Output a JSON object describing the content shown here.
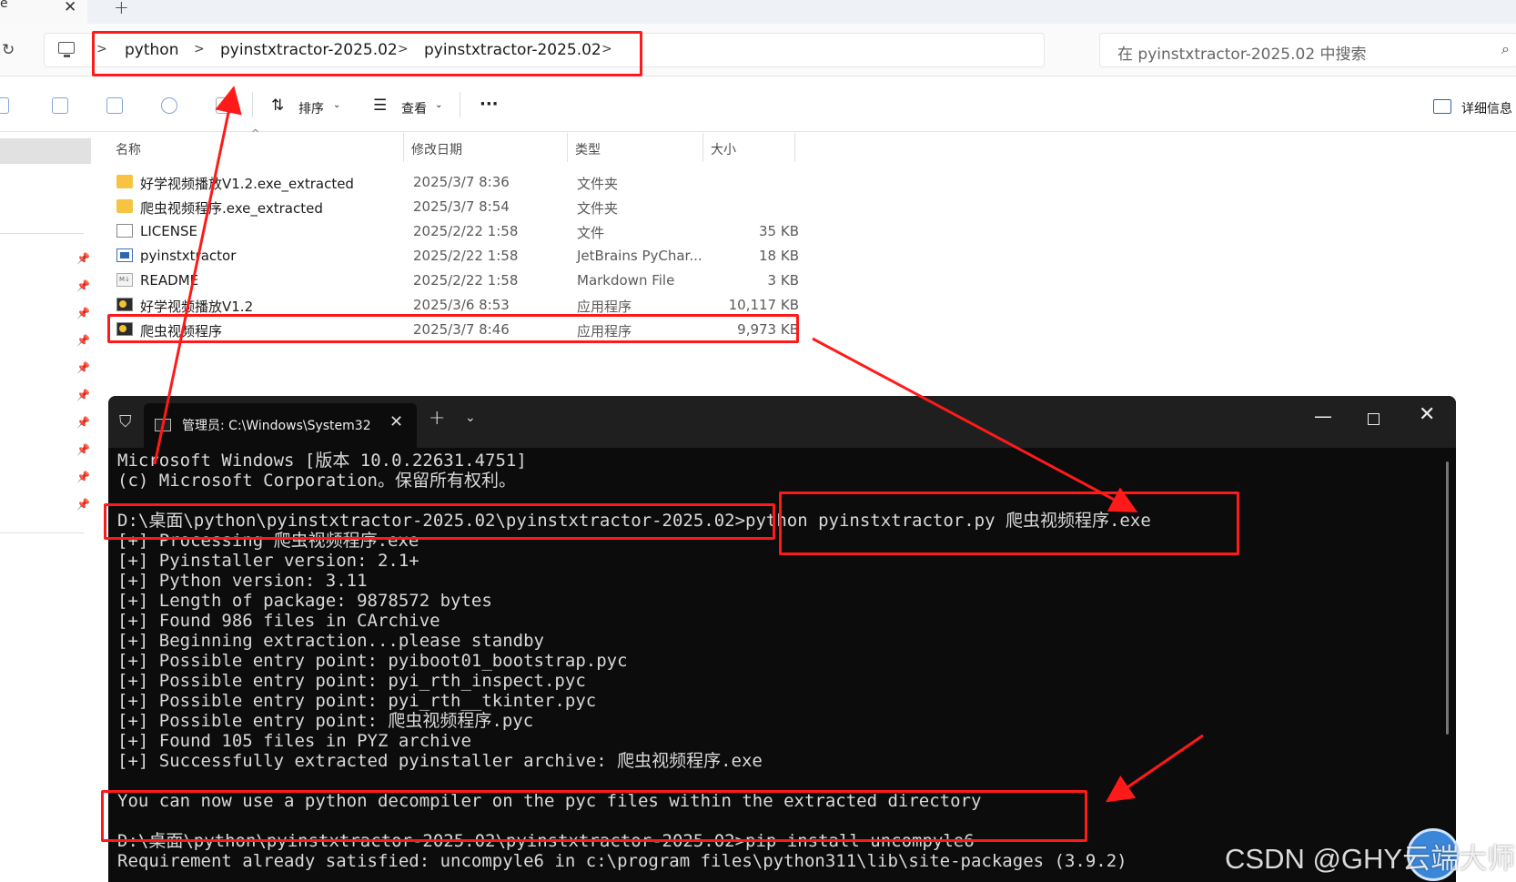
{
  "explorer": {
    "tab_fragment": "e",
    "breadcrumb": [
      "python",
      "pyinstxtractor-2025.02",
      "pyinstxtractor-2025.02"
    ],
    "search_placeholder": "在 pyinstxtractor-2025.02 中搜索",
    "toolbar": {
      "sort_label": "排序",
      "view_label": "查看",
      "more_label": "···",
      "details_label": "详细信息"
    },
    "columns": {
      "name": "名称",
      "date": "修改日期",
      "type": "类型",
      "size": "大小"
    },
    "files": [
      {
        "name": "好学视频播放V1.2.exe_extracted",
        "date": "2025/3/7 8:36",
        "type": "文件夹",
        "size": "",
        "icon": "folder-icon"
      },
      {
        "name": "爬虫视频程序.exe_extracted",
        "date": "2025/3/7 8:54",
        "type": "文件夹",
        "size": "",
        "icon": "folder-icon"
      },
      {
        "name": "LICENSE",
        "date": "2025/2/22 1:58",
        "type": "文件",
        "size": "35 KB",
        "icon": "file-icon"
      },
      {
        "name": "pyinstxtractor",
        "date": "2025/2/22 1:58",
        "type": "JetBrains PyChar...",
        "size": "18 KB",
        "icon": "pycharm-file-icon"
      },
      {
        "name": "README",
        "date": "2025/2/22 1:58",
        "type": "Markdown File",
        "size": "3 KB",
        "icon": "markdown-file-icon"
      },
      {
        "name": "好学视频播放V1.2",
        "date": "2025/3/6 8:53",
        "type": "应用程序",
        "size": "10,117 KB",
        "icon": "exe-icon"
      },
      {
        "name": "爬虫视频程序",
        "date": "2025/3/7 8:46",
        "type": "应用程序",
        "size": "9,973 KB",
        "icon": "exe-icon"
      }
    ]
  },
  "terminal": {
    "tab_title": "管理员: C:\\Windows\\System32",
    "lines": [
      "Microsoft Windows [版本 10.0.22631.4751]",
      "(c) Microsoft Corporation。保留所有权利。",
      "",
      "D:\\桌面\\python\\pyinstxtractor-2025.02\\pyinstxtractor-2025.02>python pyinstxtractor.py 爬虫视频程序.exe",
      "[+] Processing 爬虫视频程序.exe",
      "[+] Pyinstaller version: 2.1+",
      "[+] Python version: 3.11",
      "[+] Length of package: 9878572 bytes",
      "[+] Found 986 files in CArchive",
      "[+] Beginning extraction...please standby",
      "[+] Possible entry point: pyiboot01_bootstrap.pyc",
      "[+] Possible entry point: pyi_rth_inspect.pyc",
      "[+] Possible entry point: pyi_rth__tkinter.pyc",
      "[+] Possible entry point: 爬虫视频程序.pyc",
      "[+] Found 105 files in PYZ archive",
      "[+] Successfully extracted pyinstaller archive: 爬虫视频程序.exe",
      "",
      "You can now use a python decompiler on the pyc files within the extracted directory",
      "",
      "D:\\桌面\\python\\pyinstxtractor-2025.02\\pyinstxtractor-2025.02>pip install uncompyle6",
      "Requirement already satisfied: uncompyle6 in c:\\program files\\python311\\lib\\site-packages (3.9.2)"
    ]
  },
  "watermark": "CSDN @GHY云端大师",
  "colors": {
    "annotation": "#ff1a1a",
    "terminal_bg": "#0c0c0c",
    "folder": "#f6c343"
  }
}
